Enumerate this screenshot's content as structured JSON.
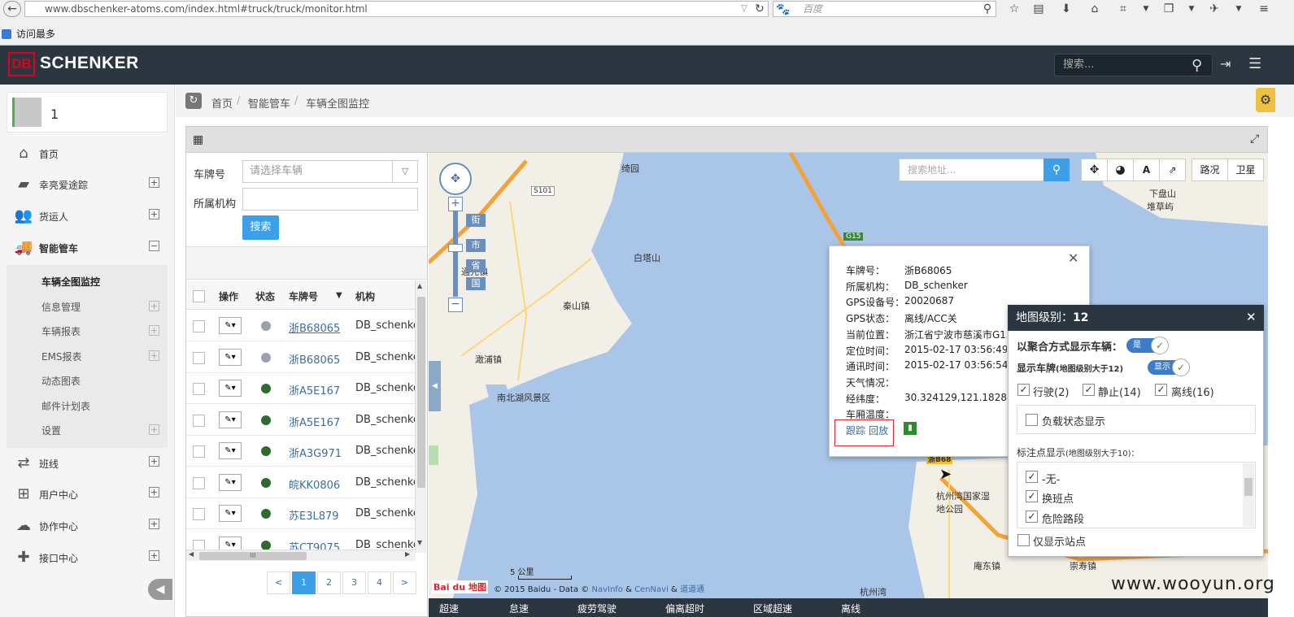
{
  "browser": {
    "url": "www.dbschenker-atoms.com/index.html#truck/truck/monitor.html",
    "search_placeholder": "百度",
    "bookmark": "访问最多"
  },
  "header": {
    "logo_db": "DB",
    "logo_text": "SCHENKER",
    "search_placeholder": "搜索..."
  },
  "sidebar": {
    "user_name": "1",
    "items": [
      {
        "label": "首页",
        "icon": "home-icon"
      },
      {
        "label": "幸亮爱途踪",
        "icon": "folder-icon"
      },
      {
        "label": "货运人",
        "icon": "users-icon"
      },
      {
        "label": "智能管车",
        "icon": "truck-icon"
      },
      {
        "label": "班线",
        "icon": "shuffle-icon"
      },
      {
        "label": "用户中心",
        "icon": "sitemap-icon"
      },
      {
        "label": "协作中心",
        "icon": "cloud-icon"
      },
      {
        "label": "接口中心",
        "icon": "puzzle-icon"
      }
    ],
    "submenu": [
      "车辆全图监控",
      "信息管理",
      "车辆报表",
      "EMS报表",
      "动态图表",
      "邮件计划表",
      "设置"
    ]
  },
  "breadcrumb": [
    "首页",
    "智能管车",
    "车辆全图监控"
  ],
  "filters": {
    "plate_label": "车牌号",
    "plate_placeholder": "请选择车辆",
    "org_label": "所属机构",
    "search_button": "搜索"
  },
  "table": {
    "headers": [
      "操作",
      "状态",
      "车牌号",
      "机构"
    ],
    "rows": [
      {
        "plate": "浙B68065",
        "status": "gray",
        "org": "DB_schenker"
      },
      {
        "plate": "浙B68065",
        "status": "gray",
        "org": "DB_schenker"
      },
      {
        "plate": "浙A5E167",
        "status": "green",
        "org": "DB_schenker"
      },
      {
        "plate": "浙A5E167",
        "status": "green",
        "org": "DB_schenker"
      },
      {
        "plate": "浙A3G971",
        "status": "green",
        "org": "DB_schenker"
      },
      {
        "plate": "皖KK0806",
        "status": "green",
        "org": "DB_schenker"
      },
      {
        "plate": "苏E3L879",
        "status": "green",
        "org": "DB_schenker"
      },
      {
        "plate": "苏CT9075",
        "status": "green",
        "org": "DB_schenker"
      }
    ],
    "scroll_mark": "III"
  },
  "pagination": {
    "prev": "<",
    "pages": [
      "1",
      "2",
      "3",
      "4"
    ],
    "next": ">",
    "current": "1"
  },
  "map": {
    "search_placeholder": "搜索地址...",
    "traffic_button": "路况",
    "satellite_button": "卫星",
    "zoom_in": "+",
    "zoom_out": "−",
    "levels": [
      "街",
      "市",
      "省",
      "国"
    ],
    "labels": {
      "l1": "绮园",
      "l2": "S101",
      "l3": "白塔山",
      "l4": "秦山镇",
      "l5": "澉浦镇",
      "l6": "南北湖风景区",
      "l7": "G15",
      "l8": "杭州湾国家湿地公园",
      "l9": "庵东镇",
      "l10": "崇寿镇",
      "l11": "杭州湾",
      "l12": "下盘山",
      "l13": "堆草屿",
      "l14": "通元镇",
      "l15": "浙B68"
    },
    "scale": "5 公里",
    "copyright": "© 2015 Baidu - Data ©",
    "providers": [
      "NavInfo",
      "CenNavi",
      "道道通"
    ],
    "baidu_logo": "Bai du 地图"
  },
  "info_window": {
    "fields": [
      {
        "label": "车牌号：",
        "value": "浙B68065"
      },
      {
        "label": "所属机构：",
        "value": "DB_schenker"
      },
      {
        "label": "GPS设备号：",
        "value": "20020687"
      },
      {
        "label": "GPS状态：",
        "value": "离线/ACC关"
      },
      {
        "label": "当前位置：",
        "value": "浙江省宁波市慈溪市G15"
      },
      {
        "label": "定位时间：",
        "value": "2015-02-17 03:56:49"
      },
      {
        "label": "通讯时间：",
        "value": "2015-02-17 03:56:54"
      },
      {
        "label": "天气情况：",
        "value": ""
      },
      {
        "label": "经纬度：",
        "value": "30.324129,121.182877"
      },
      {
        "label": "车厢温度：",
        "value": ""
      }
    ],
    "track_link": "跟踪",
    "playback_link": "回放"
  },
  "layer_panel": {
    "title_prefix": "地图级别：",
    "level": "12",
    "cluster_label": "以聚合方式显示车辆：",
    "cluster_toggle": "是",
    "plate_label": "显示车牌",
    "plate_hint": "(地图级别大于12)",
    "plate_toggle": "显示",
    "statuses": [
      "行驶(2)",
      "静止(14)",
      "离线(16)"
    ],
    "load_status": "负载状态显示",
    "markers_label": "标注点显示",
    "markers_hint": "(地图级别大于10)：",
    "markers": [
      "-无-",
      "换班点",
      "危险路段"
    ],
    "only_stations": "仅显示站点"
  },
  "bottom_tabs": [
    "超速",
    "怠速",
    "疲劳驾驶",
    "偏离超时",
    "区域超速",
    "离线"
  ],
  "watermark": "www.wooyun.org",
  "colors": {
    "header": "#2c3640",
    "accent": "#3c9fe8",
    "online": "#2e6b2e",
    "offline": "#9aa3ad",
    "db_red": "#e2001a"
  }
}
